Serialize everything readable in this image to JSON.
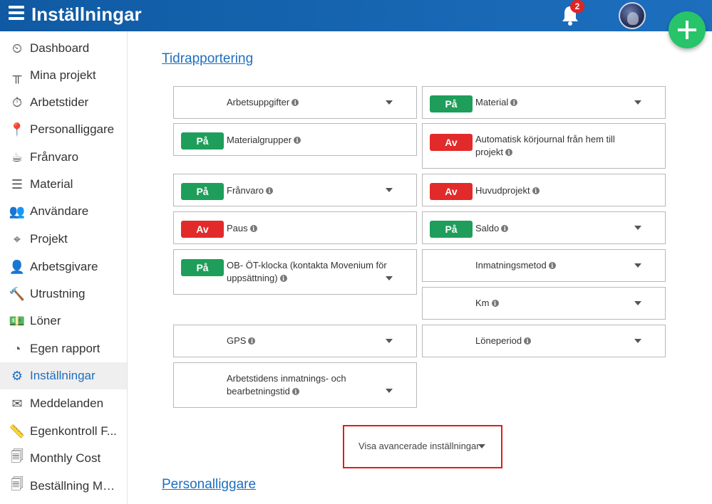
{
  "header": {
    "title": "Inställningar",
    "notification_count": "2"
  },
  "sidebar": {
    "items": [
      {
        "label": "Dashboard",
        "icon": "dashboard-gauge-icon",
        "glyph": "⏲"
      },
      {
        "label": "Mina projekt",
        "icon": "fence-icon",
        "glyph": "╥"
      },
      {
        "label": "Arbetstider",
        "icon": "stopwatch-icon",
        "glyph": "⏱"
      },
      {
        "label": "Personalliggare",
        "icon": "map-pin-icon",
        "glyph": "📍"
      },
      {
        "label": "Frånvaro",
        "icon": "coffee-cup-icon",
        "glyph": "☕"
      },
      {
        "label": "Material",
        "icon": "list-icon",
        "glyph": "☰"
      },
      {
        "label": "Användare",
        "icon": "users-icon",
        "glyph": "👥"
      },
      {
        "label": "Projekt",
        "icon": "location-icon",
        "glyph": "⌖"
      },
      {
        "label": "Arbetsgivare",
        "icon": "user-icon",
        "glyph": "👤"
      },
      {
        "label": "Utrustning",
        "icon": "hammer-icon",
        "glyph": "🔨"
      },
      {
        "label": "Löner",
        "icon": "money-icon",
        "glyph": "💵"
      },
      {
        "label": "Egen rapport",
        "icon": "pie-chart-icon",
        "glyph": "◔"
      },
      {
        "label": "Inställningar",
        "icon": "gear-icon",
        "glyph": "⚙"
      },
      {
        "label": "Meddelanden",
        "icon": "envelope-icon",
        "glyph": "✉"
      },
      {
        "label": "Egenkontroll F...",
        "icon": "ruler-icon",
        "glyph": "📏"
      },
      {
        "label": "Monthly Cost",
        "icon": "documents-icon",
        "glyph": "🗐"
      },
      {
        "label": "Beställning Ma...",
        "icon": "documents-icon",
        "glyph": "🗐"
      }
    ]
  },
  "main": {
    "section1": "Tidrapportering",
    "section2": "Personalliggare",
    "toggle_on": "På",
    "toggle_off": "Av",
    "settings": {
      "arbetsuppgifter": "Arbetsuppgifter",
      "material": "Material",
      "materialgrupper": "Materialgrupper",
      "automatisk_korjournal": "Automatisk körjournal från hem till projekt",
      "franvaro": "Frånvaro",
      "huvudprojekt": "Huvudprojekt",
      "paus": "Paus",
      "saldo": "Saldo",
      "ob_ot_klocka": "OB- ÖT-klocka (kontakta Movenium för uppsättning)",
      "inmatningsmetod": "Inmatningsmetod",
      "km": "Km",
      "gps": "GPS",
      "loneperiod": "Löneperiod",
      "arbetstidens_inmatning": "Arbetstidens inmatnings- och bearbetningstid"
    },
    "advanced_label": "Visa avancerade inställningar"
  },
  "colors": {
    "header": "#1466b4",
    "on": "#1e9e5a",
    "off": "#e22a2a",
    "fab": "#27c46a",
    "highlight": "#e21b1b",
    "link": "#1e6fbf"
  }
}
